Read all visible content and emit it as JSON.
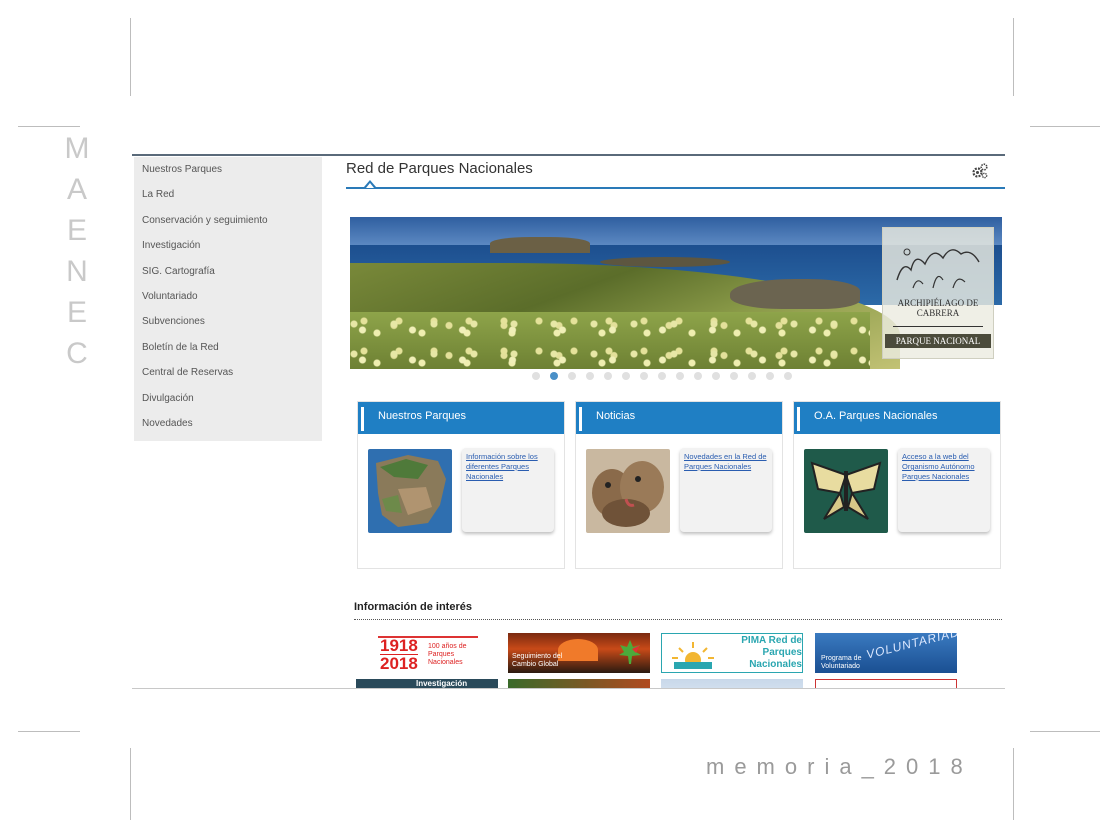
{
  "side_text": [
    "C",
    "E",
    "N",
    "E",
    "A",
    "M"
  ],
  "footer_text": "memoria_2018",
  "sidebar": {
    "items": [
      {
        "label": "Nuestros Parques"
      },
      {
        "label": "La Red"
      },
      {
        "label": "Conservación y seguimiento"
      },
      {
        "label": "Investigación"
      },
      {
        "label": "SIG. Cartografía"
      },
      {
        "label": "Voluntariado"
      },
      {
        "label": "Subvenciones"
      },
      {
        "label": "Boletín de la Red"
      },
      {
        "label": "Central de Reservas"
      },
      {
        "label": "Divulgación"
      },
      {
        "label": "Novedades"
      }
    ]
  },
  "header": {
    "title": "Red de Parques Nacionales",
    "settings_icon": "gears-icon",
    "accent_color": "#2a7ab8"
  },
  "hero": {
    "logo_title": "ARCHIPIÉLAGO DE CABRERA",
    "logo_subtitle": "PARQUE NACIONAL",
    "slide_count": 15,
    "active_slide": 2
  },
  "cards": [
    {
      "title": "Nuestros Parques",
      "link": "Información sobre los diferentes Parques Nacionales",
      "image": "iberian-peninsula-map"
    },
    {
      "title": "Noticias",
      "link": "Novedades en la Red de Parques Nacionales",
      "image": "lynx-cubs"
    },
    {
      "title": "O.A. Parques Nacionales",
      "link": "Acceso a la web del Organismo Autónomo Parques Nacionales",
      "image": "swallowtail-butterfly"
    }
  ],
  "interest": {
    "title": "Información de interés",
    "banners": [
      {
        "line1": "1918",
        "line2": "2018",
        "caption": "100 años de Parques Nacionales"
      },
      {
        "caption": "Seguimiento del Cambio Global"
      },
      {
        "title": "PIMA Red de Parques Nacionales"
      },
      {
        "caption": "Programa de Voluntariado",
        "overlay": "VOLUNTARIADO"
      },
      {
        "caption": "Investigación"
      }
    ]
  }
}
